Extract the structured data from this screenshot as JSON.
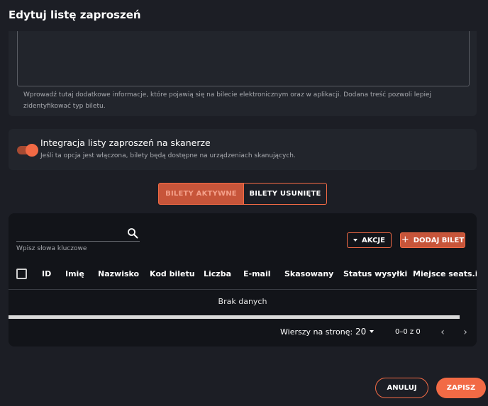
{
  "modal": {
    "title": "Edytuj listę zaproszeń"
  },
  "description": {
    "helper": "Wprowadź tutaj dodatkowe informacje, które pojawią się na bilecie elektronicznym oraz w aplikacji. Dodana treść pozwoli lepiej zidentyfikować typ biletu."
  },
  "scanner": {
    "toggle_on": true,
    "title": "Integracja listy zaproszeń na skanerze",
    "subtitle": "Jeśli ta opcja jest włączona, bilety będą dostępne na urządzeniach skanujących."
  },
  "tabs": [
    {
      "label": "BILETY AKTYWNE",
      "active": true
    },
    {
      "label": "BILETY USUNIĘTE",
      "active": false
    }
  ],
  "table": {
    "search_hint": "Wpisz słowa kluczowe",
    "actions_label": "AKCJE",
    "add_label": "DODAJ BILET",
    "columns": [
      "ID",
      "Imię",
      "Nazwisko",
      "Kod biletu",
      "Liczba",
      "E-mail",
      "Skasowany",
      "Status wysyłki",
      "Miejsce seats.io"
    ],
    "empty_text": "Brak danych",
    "rows_per_page_label": "Wierszy na stronę:",
    "rows_per_page": "20",
    "range": "0–0 z 0"
  },
  "footer": {
    "cancel_label": "ANULUJ",
    "save_label": "ZAPISZ"
  },
  "colors": {
    "accent": "#f26a45",
    "accent_dark": "#c7553a",
    "background": "#1c1e25",
    "card": "#22252c",
    "table_bg": "#121419"
  }
}
